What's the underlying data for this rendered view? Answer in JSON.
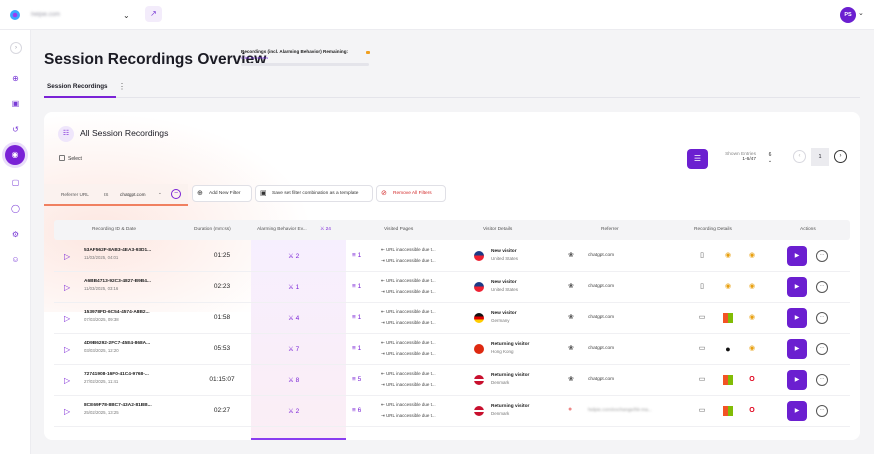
{
  "topbar": {
    "site": "helpie.com",
    "avatar": "PS"
  },
  "header": {
    "title": "Session Recordings Overview",
    "quota_title": "Recordings (incl. Alarming Behavior) Remaining:",
    "quota_link": "Click for details"
  },
  "tabs": {
    "active": "Session Recordings"
  },
  "card": {
    "title": "All Session Recordings",
    "select_label": "Select"
  },
  "pagination": {
    "shown_label": "Shown Entries",
    "shown_range": "1-6/47",
    "page_size": "6",
    "page": "1"
  },
  "filters": {
    "chip": {
      "field": "Referrer URL",
      "op": "IS",
      "value": "chatgpt.com"
    },
    "add_label": "Add New Filter",
    "save_label": "Save set filter combination as a template",
    "remove_label": "Remove All Filters"
  },
  "table": {
    "headers": {
      "id_date": "Recording ID & Date",
      "duration": "Duration (mm:ss)",
      "alarming": "Alarming Behavior Ev...",
      "alarming_count": "24",
      "visited": "Visited Pages",
      "visitor": "Visitor Details",
      "referrer": "Referrer",
      "details": "Recording Details",
      "actions": "Actions"
    },
    "rows": [
      {
        "id": "53AF562F-8AB3-4EA3-93D1...",
        "date": "11/03/2025, 04:01",
        "duration": "01:25",
        "alarm": "2",
        "pages": "1",
        "page1": "URL inaccessible due t...",
        "page2": "URL inaccessible due t...",
        "visitor": "New visitor",
        "country": "United States",
        "referrer": "chatgpt.com"
      },
      {
        "id": "A6BB4713-92C3-4827-B9B4...",
        "date": "11/03/2025, 03:16",
        "duration": "02:23",
        "alarm": "1",
        "pages": "1",
        "page1": "URL inaccessible due t...",
        "page2": "URL inaccessible due t...",
        "visitor": "New visitor",
        "country": "United States",
        "referrer": "chatgpt.com"
      },
      {
        "id": "153978FD-6C54-4574-A8B2...",
        "date": "07/03/2025, 09:38",
        "duration": "01:58",
        "alarm": "4",
        "pages": "1",
        "page1": "URL inaccessible due t...",
        "page2": "URL inaccessible due t...",
        "visitor": "New visitor",
        "country": "Germany",
        "referrer": "chatgpt.com"
      },
      {
        "id": "4D9B6292-2FC7-45E4-868A...",
        "date": "03/03/2025, 12:20",
        "duration": "05:53",
        "alarm": "7",
        "pages": "1",
        "page1": "URL inaccessible due t...",
        "page2": "URL inaccessible due t...",
        "visitor": "Returning visitor",
        "country": "Hong Kong",
        "referrer": "chatgpt.com"
      },
      {
        "id": "72741908-16F0-41C4-9768-...",
        "date": "27/02/2025, 11:41",
        "duration": "01:15:07",
        "alarm": "8",
        "pages": "5",
        "page1": "URL inaccessible due t...",
        "page2": "URL inaccessible due t...",
        "visitor": "Returning visitor",
        "country": "Denmark",
        "referrer": "chatgpt.com"
      },
      {
        "id": "8CE69F78-8BC7-43A2-81BB...",
        "date": "25/02/2025, 13:25",
        "duration": "02:27",
        "alarm": "2",
        "pages": "6",
        "page1": "URL inaccessible due t...",
        "page2": "URL inaccessible due t...",
        "visitor": "Returning visitor",
        "country": "Denmark",
        "referrer": "helpie.com/exchange/hk-ma..."
      }
    ]
  },
  "colors": {
    "brand": "#6b1fd0",
    "accent_highlight": "#8a3df0",
    "danger": "#d32a2a"
  }
}
